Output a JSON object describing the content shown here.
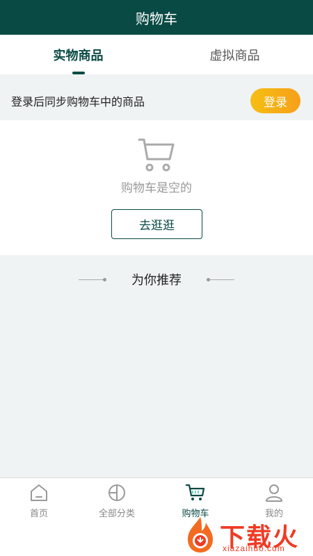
{
  "header": {
    "title": "购物车"
  },
  "tabs": [
    {
      "label": "实物商品",
      "active": true
    },
    {
      "label": "虚拟商品",
      "active": false
    }
  ],
  "login_bar": {
    "text": "登录后同步购物车中的商品",
    "button": "登录"
  },
  "empty_cart": {
    "icon": "cart-icon",
    "text": "购物车是空的",
    "button": "去逛逛"
  },
  "recommend": {
    "title": "为你推荐"
  },
  "tabbar": {
    "items": [
      {
        "label": "首页",
        "icon": "home-icon",
        "active": false
      },
      {
        "label": "全部分类",
        "icon": "category-icon",
        "active": false
      },
      {
        "label": "购物车",
        "icon": "cart-icon",
        "active": true
      },
      {
        "label": "我的",
        "icon": "user-icon",
        "active": false
      }
    ]
  },
  "watermark": {
    "text": "下载火",
    "sub": "xiazaihuo.com"
  },
  "colors": {
    "primary": "#0a4a44",
    "accent": "#f6b016",
    "background": "#eff3f3",
    "watermark": "#ef3b24"
  }
}
